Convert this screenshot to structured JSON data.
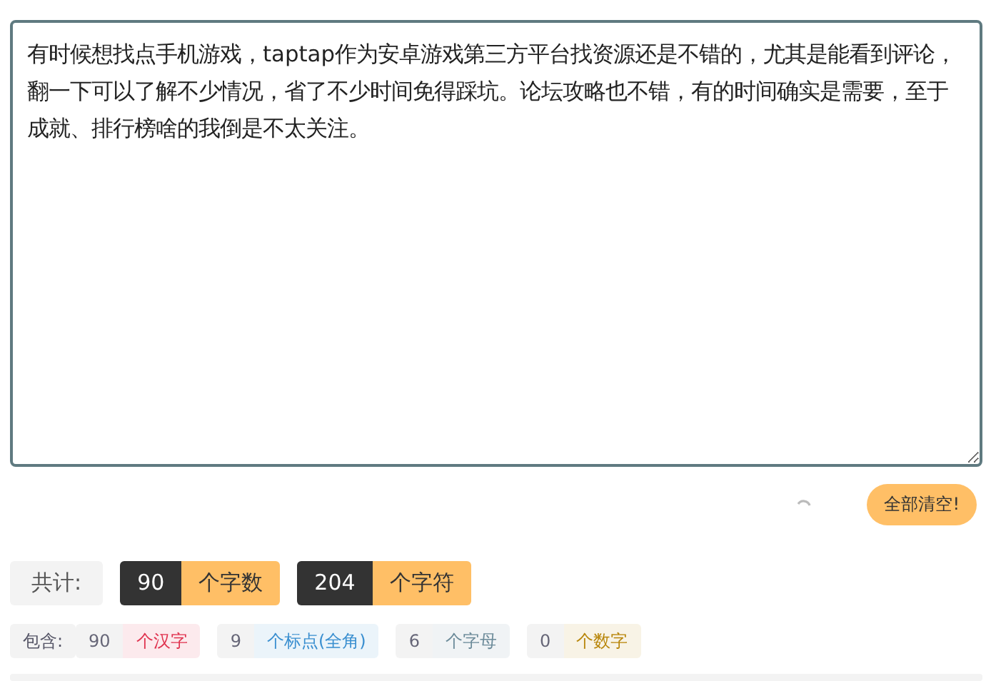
{
  "editor": {
    "value": "有时候想找点手机游戏，taptap作为安卓游戏第三方平台找资源还是不错的，尤其是能看到评论，翻一下可以了解不少情况，省了不少时间免得踩坑。论坛攻略也不错，有的时间确实是需要，至于成就、排行榜啥的我倒是不太关注。"
  },
  "clear_button": {
    "label": "全部清空!"
  },
  "totals": {
    "label": "共计:",
    "items": [
      {
        "count": "90",
        "unit": "个字数"
      },
      {
        "count": "204",
        "unit": "个字符"
      }
    ]
  },
  "breakdown": {
    "label": "包含:",
    "items": [
      {
        "count": "90",
        "unit": "个汉字",
        "color": "#e0334f"
      },
      {
        "count": "9",
        "unit": "个标点(全角)",
        "color": "#3a8fd0"
      },
      {
        "count": "6",
        "unit": "个字母",
        "color": "#6b8a99"
      },
      {
        "count": "0",
        "unit": "个数字",
        "color": "#b8860b"
      }
    ]
  }
}
